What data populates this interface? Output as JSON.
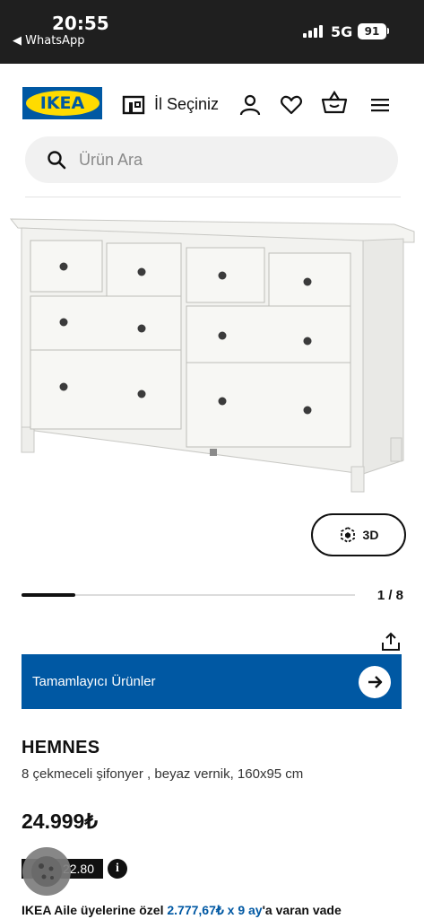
{
  "status_bar": {
    "time": "20:55",
    "back_app": "◀ WhatsApp",
    "network": "5G",
    "battery": "91"
  },
  "header": {
    "logo_text": "IKEA",
    "store_label": "İl Seçiniz"
  },
  "search": {
    "placeholder": "Ürün Ara"
  },
  "viewer": {
    "button_3d_label": "3D",
    "carousel_count": "1 / 8",
    "carousel_progress": 0.125
  },
  "banner": {
    "label": "Tamamlayıcı Ürünler"
  },
  "product": {
    "name": "HEMNES",
    "description": "8 çekmeceli şifonyer , beyaz vernik, 160x95 cm",
    "price": "24.999₺",
    "old_price": ".22.80",
    "info_symbol": "i"
  },
  "installment": {
    "prefix": "IKEA Aile üyelerine özel ",
    "highlight": "2.777,67₺ x 9 ay",
    "suffix": "'a varan vade"
  },
  "colors": {
    "brand_blue": "#0058a3",
    "brand_yellow": "#ffdb00",
    "status_bar": "#1f1f1f"
  }
}
